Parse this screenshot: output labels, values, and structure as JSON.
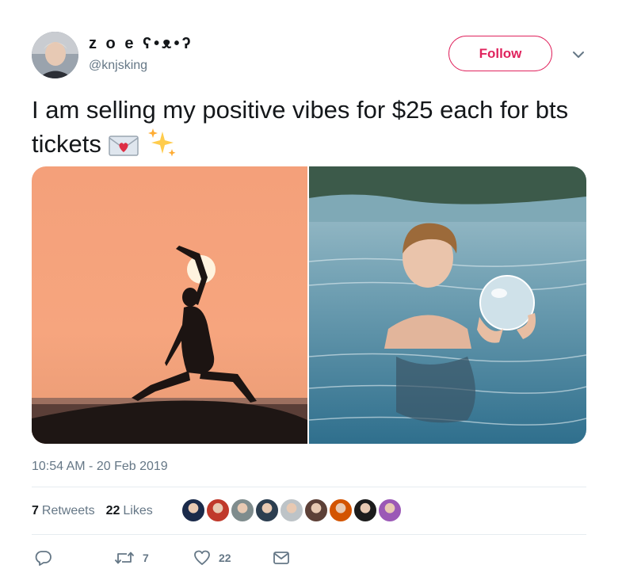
{
  "user": {
    "display_name": "z o e ʕ•ᴥ•ʔ",
    "handle": "@knjsking"
  },
  "follow_label": "Follow",
  "tweet": {
    "text": "I am selling my positive vibes for $25 each for bts tickets",
    "emojis": [
      "love-letter-icon",
      "sparkles-icon"
    ]
  },
  "media": [
    {
      "description": "yoga silhouette at sunset",
      "icon": "image"
    },
    {
      "description": "woman in water holding crystal ball",
      "icon": "image"
    }
  ],
  "timestamp": "10:54 AM - 20 Feb 2019",
  "stats": {
    "retweets_count": "7",
    "retweets_label": "Retweets",
    "likes_count": "22",
    "likes_label": "Likes"
  },
  "likers": [
    "#1a2a4a",
    "#c0392b",
    "#7f8c8d",
    "#2c3e50",
    "#bdc3c7",
    "#5d4037",
    "#d35400",
    "#1c1c1c",
    "#9b59b6"
  ],
  "actions": {
    "reply_count": "",
    "retweet_count": "7",
    "like_count": "22"
  },
  "colors": {
    "accent": "#e0245e",
    "muted": "#657786",
    "text": "#14171a"
  }
}
